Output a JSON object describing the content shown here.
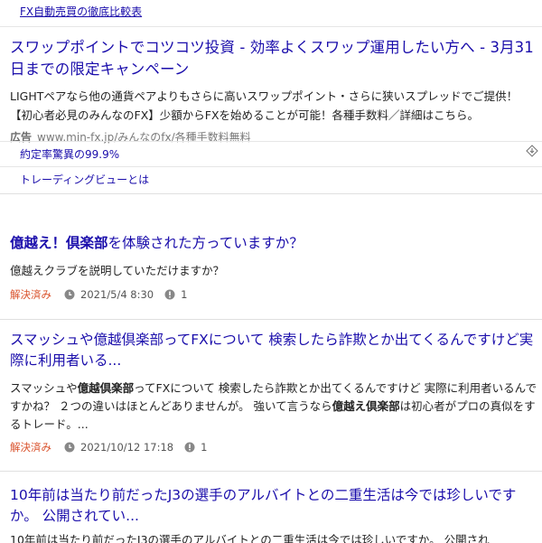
{
  "top_link": {
    "label": "FX自動売買の徹底比較表"
  },
  "ad": {
    "title": "スワップポイントでコツコツ投資 - 効率よくスワップ運用したい方へ - 3月31日までの限定キャンペーン",
    "description": "LIGHTペアなら他の通貨ペアよりもさらに高いスワップポイント・さらに狭いスプレッドでご提供！【初心者必見のみんなのFX】少額からFXを始めることが可能！各種手数料／詳細はこちら。",
    "badge": "広告",
    "url": "www.min-fx.jp/みんなのfx/各種手数料無料",
    "sublinks": [
      "約定率驚異の99.9%",
      "トレーディングビューとは"
    ]
  },
  "results": [
    {
      "title_hl": "億越え！倶楽部",
      "title_rest": "を体験された方っていますか？",
      "description": "億越えクラブを説明していただけますか？",
      "status": "解決済み",
      "date": "2021/5/4 8:30",
      "answers": "1"
    },
    {
      "title": "スマッシュや億越倶楽部ってFXについて 検索したら詐欺とか出てくるんですけど実際に利用者いる...",
      "desc_a": "スマッシュや",
      "desc_b": "億越倶楽部",
      "desc_c": "ってFXについて 検索したら詐欺とか出てくるんですけど 実際に利用者いるんですかね？ ２つの違いはほとんどありませんが。 強いて言うなら",
      "desc_d": "億越え倶楽部",
      "desc_e": "は初心者がプロの真似をするトレード。...",
      "status": "解決済み",
      "date": "2021/10/12 17:18",
      "answers": "1"
    },
    {
      "title": "10年前は当たり前だったJ3の選手のアルバイトとの二重生活は今では珍しいですか。 公開されてい...",
      "description": "10年前は当たり前だったJ3の選手のアルバイトとの二重生活は今では珍しいですか。 公開され"
    }
  ],
  "colors": {
    "link": "#1a0dab",
    "status": "#d9502a",
    "meta": "#555555"
  },
  "icons": [
    "clock-icon",
    "answer-count-icon",
    "adchoices-icon"
  ]
}
